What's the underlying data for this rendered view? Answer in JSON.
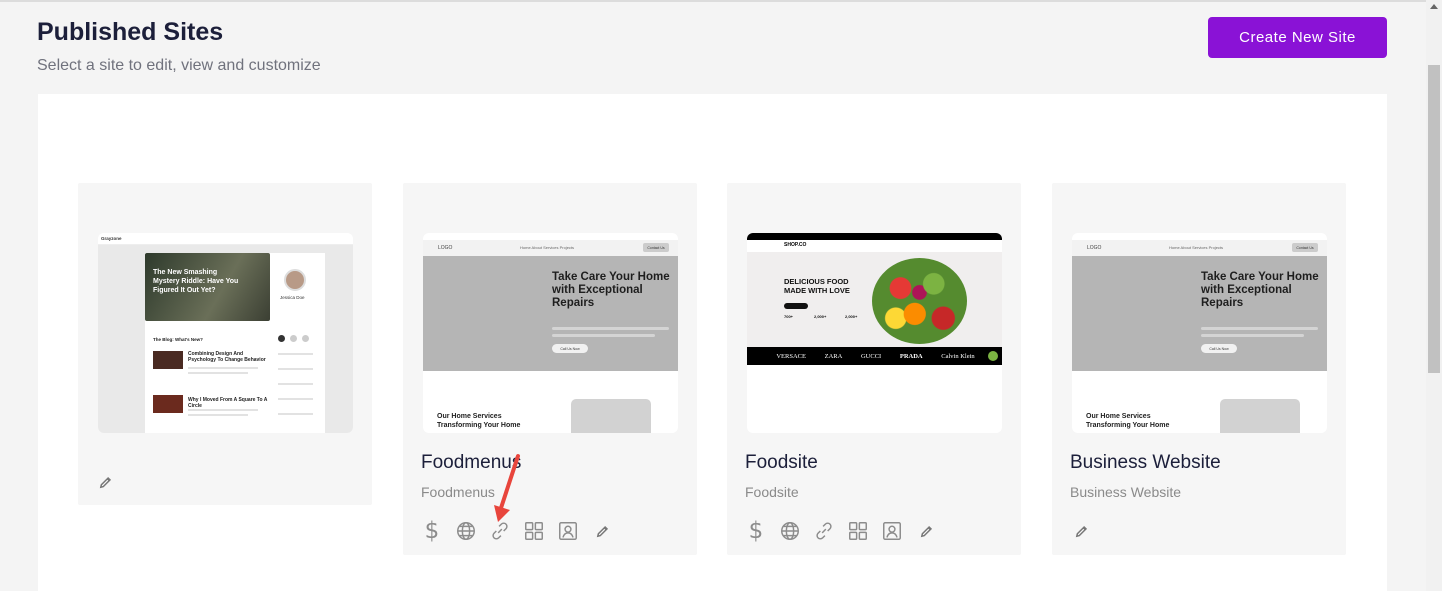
{
  "header": {
    "title": "Published Sites",
    "subtitle": "Select a site to edit, view and customize",
    "create_button": "Create New Site"
  },
  "cards": [
    {
      "name": "",
      "subtitle": "",
      "preview": {
        "brand": "Grayzone",
        "hero_title": "The New Smashing Mystery Riddle: Have You Figured It Out Yet?",
        "author": "Jessica Doe",
        "section": "The Blog: What's New?",
        "posts": [
          "Combining Design And Psychology To Change Behavior",
          "Why I Moved From A Square To A Circle"
        ]
      },
      "actions": [
        "pencil-icon"
      ]
    },
    {
      "name": "Foodmenus",
      "subtitle": "Foodmenus",
      "preview": {
        "logo": "LOGO",
        "nav": "Home   About   Services   Projects",
        "contact": "Contact Us",
        "hero_title": "Take Care Your Home with Exceptional Repairs",
        "call": "Call Us Now",
        "section": "Our Home Services Transforming Your Home"
      },
      "actions": [
        "dollar-icon",
        "globe-icon",
        "link-icon",
        "grid-icon",
        "contact-icon",
        "pencil-icon"
      ]
    },
    {
      "name": "Foodsite",
      "subtitle": "Foodsite",
      "preview": {
        "logo": "SHOP.CO",
        "hero_title": "DELICIOUS FOOD MADE WITH LOVE",
        "stats": [
          "700+",
          "2,000+",
          "2,000+"
        ],
        "brands": [
          "VERSACE",
          "ZARA",
          "GUCCI",
          "PRADA",
          "Calvin Klein"
        ]
      },
      "actions": [
        "dollar-icon",
        "globe-icon",
        "link-icon",
        "grid-icon",
        "contact-icon",
        "pencil-icon"
      ]
    },
    {
      "name": "Business Website",
      "subtitle": "Business Website",
      "preview": {
        "logo": "LOGO",
        "nav": "Home   About   Services   Projects",
        "contact": "Contact Us",
        "hero_title": "Take Care Your Home with Exceptional Repairs",
        "call": "Call Us Now",
        "section": "Our Home Services Transforming Your Home"
      },
      "actions": [
        "pencil-icon"
      ]
    }
  ],
  "colors": {
    "accent": "#8a12d6",
    "annotation_arrow": "#e8453c"
  }
}
